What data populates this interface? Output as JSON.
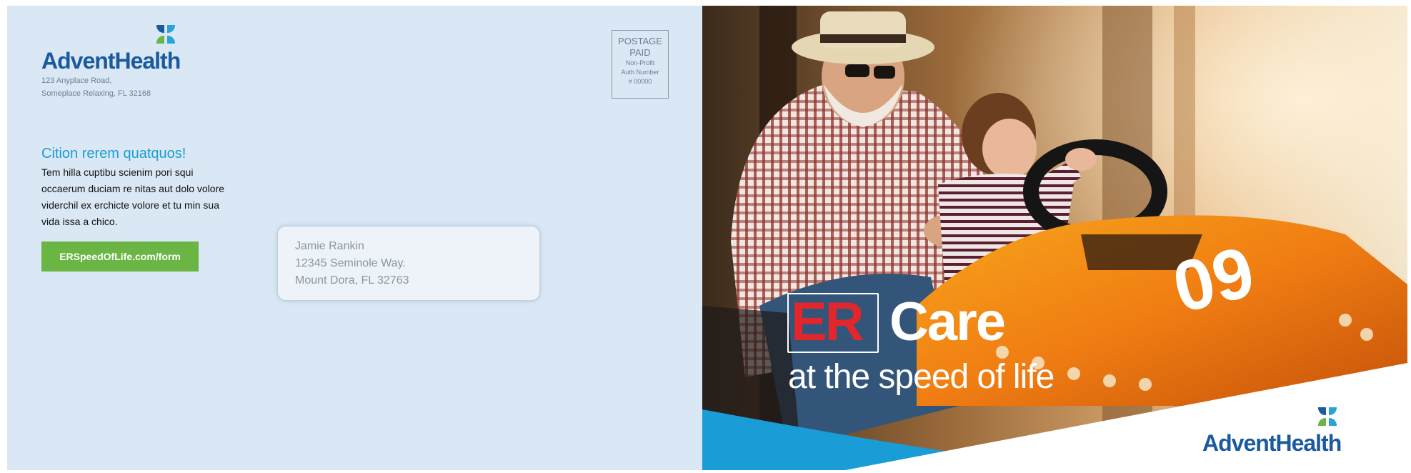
{
  "brand": {
    "logo_text": "AdventHealth",
    "colors": {
      "logo_blue": "#1b5a9e",
      "accent_blue": "#1a9cd6",
      "cta_green": "#6ab543",
      "er_red": "#e1262c",
      "panel_bg": "#d9e8f4"
    }
  },
  "return_address": {
    "line1": "123 Anyplace Road,",
    "line2": "Someplace Relaxing, FL 32168"
  },
  "postage": {
    "line1": "POSTAGE",
    "line2": "PAID",
    "line3": "Non-Profit",
    "line4": "Auth Number",
    "line5": "# 00000"
  },
  "message": {
    "headline": "Cition rerem quatquos!",
    "body": "Tem hilla cuptibu scienim pori squi occaerum duciam re nitas aut dolo volore viderchil ex erchicte volore et tu min sua vida issa a chico."
  },
  "cta": {
    "label": "ERSpeedOfLife.com/form"
  },
  "recipient": {
    "name": "Jamie Rankin",
    "street": "12345 Seminole Way.",
    "city_state_zip": "Mount Dora, FL 32763"
  },
  "cover": {
    "er": "ER",
    "care": "Care",
    "tagline": "at the speed of life"
  },
  "icons": {
    "logo_mark": "four-leaf-logo-icon"
  }
}
